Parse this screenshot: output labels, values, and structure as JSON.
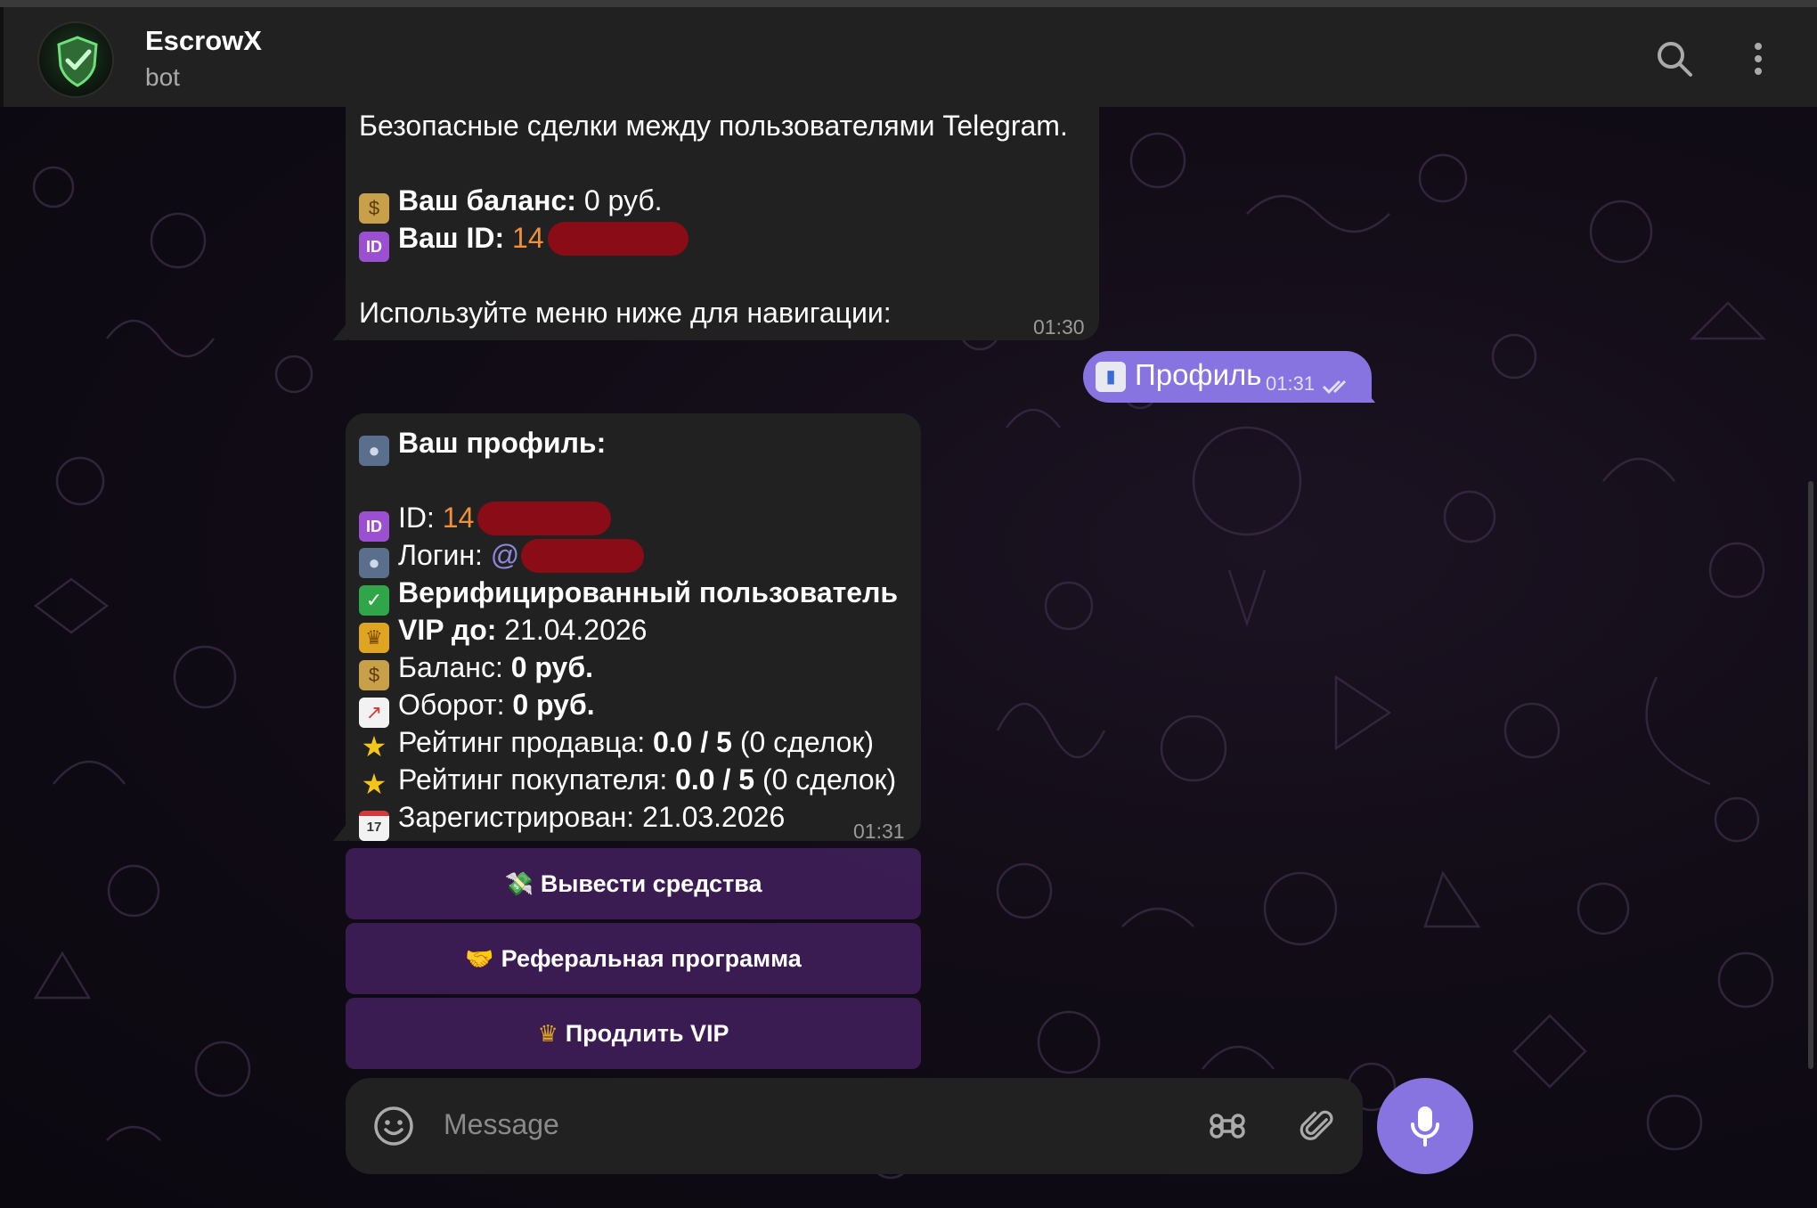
{
  "header": {
    "title": "EscrowX",
    "subtitle": "bot"
  },
  "message1": {
    "line1": "Безопасные сделки между пользователями Telegram.",
    "balance_label": "Ваш баланс:",
    "balance_value": " 0 руб.",
    "id_label": "Ваш ID:",
    "id_value": "14",
    "nav_hint": "Используйте меню ниже для навигации:",
    "time": "01:30"
  },
  "outgoing": {
    "text": "Профиль",
    "time": "01:31"
  },
  "profile": {
    "title": "Ваш профиль:",
    "id_label": "ID: ",
    "id_value": "14",
    "login_label": "Логин: ",
    "login_value": "@",
    "verified": "Верифицированный пользователь",
    "vip_label": "VIP до:",
    "vip_value": " 21.04.2026",
    "balance_label": "Баланс: ",
    "balance_value": "0 руб.",
    "turnover_label": "Оборот: ",
    "turnover_value": "0 руб.",
    "seller_label": "Рейтинг продавца: ",
    "seller_value": "0.0 / 5",
    "seller_deals": " (0 сделок)",
    "buyer_label": "Рейтинг покупателя: ",
    "buyer_value": "0.0 / 5",
    "buyer_deals": " (0 сделок)",
    "registered": "Зарегистрирован: 21.03.2026",
    "time": "01:31"
  },
  "keyboard": {
    "withdraw": "Вывести средства",
    "referral": "Реферальная программа",
    "extend_vip": "Продлить VIP"
  },
  "composer": {
    "placeholder": "Message"
  },
  "colors": {
    "accent": "#8774e1",
    "bubble": "#212121",
    "id_orange": "#f0903c",
    "button_bg": "#3e1e58"
  }
}
